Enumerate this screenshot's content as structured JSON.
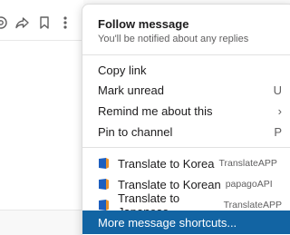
{
  "menu": {
    "follow": {
      "title": "Follow message",
      "subtitle": "You'll be notified about any replies"
    },
    "items": [
      {
        "label": "Copy link",
        "shortcut": ""
      },
      {
        "label": "Mark unread",
        "shortcut": "U"
      },
      {
        "label": "Remind me about this",
        "shortcut": "›"
      },
      {
        "label": "Pin to channel",
        "shortcut": "P"
      }
    ],
    "translate": [
      {
        "label": "Translate to Korea",
        "app": "TranslateAPP"
      },
      {
        "label": "Translate to Korean",
        "app": "papagoAPI"
      },
      {
        "label": "Translate to Japanese",
        "app": "TranslateAPP"
      }
    ],
    "more": "More message shortcuts..."
  },
  "colors": {
    "highlight": "#1264a3",
    "app_icon_blue": "#1d5fbf",
    "app_icon_orange": "#e8912d"
  },
  "icons": [
    "reaction-icon",
    "share-icon",
    "bookmark-icon",
    "more-actions-icon"
  ]
}
